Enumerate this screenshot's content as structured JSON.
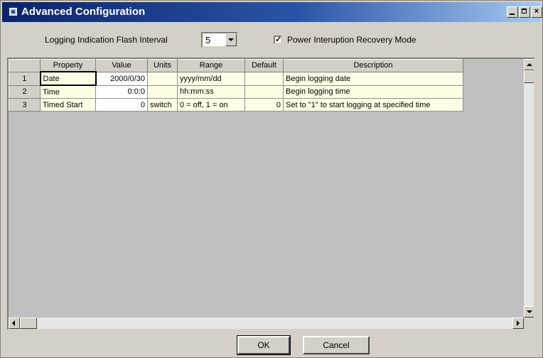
{
  "window": {
    "title": "Advanced Configuration",
    "controls": {
      "minimize": "",
      "maximize": "",
      "close": "×"
    }
  },
  "settings": {
    "flash_interval_label": "Logging Indication Flash Interval",
    "flash_interval_value": "5",
    "power_recovery_label": "Power Interuption Recovery Mode",
    "power_recovery_checked": true,
    "check_glyph": "✓"
  },
  "table": {
    "columns": [
      "Property",
      "Value",
      "Units",
      "Range",
      "Default",
      "Description"
    ],
    "rows": [
      {
        "num": "1",
        "property": "Date",
        "value": "2000/0/30",
        "units": "",
        "range": "yyyy/mm/dd",
        "default": "",
        "description": "Begin logging date"
      },
      {
        "num": "2",
        "property": "Time",
        "value": "0:0:0",
        "units": "",
        "range": "hh:mm:ss",
        "default": "",
        "description": "Begin logging time"
      },
      {
        "num": "3",
        "property": "Timed Start",
        "value": "0",
        "units": "switch",
        "range": "0 = off, 1 = on",
        "default": "0",
        "description": "Set to \"1\" to start logging at specified time"
      }
    ]
  },
  "buttons": {
    "ok": "OK",
    "cancel": "Cancel"
  },
  "colors": {
    "title_bar": "#0a246a",
    "cell_background": "#ffffe6",
    "window_face": "#d4d0c8"
  }
}
